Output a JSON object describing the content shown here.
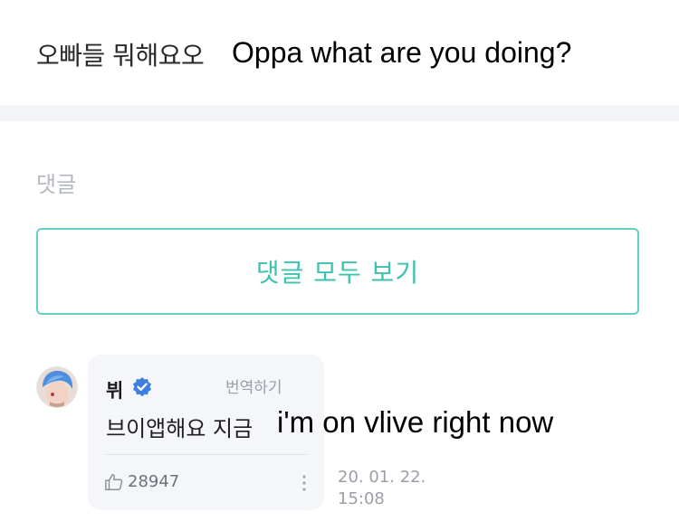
{
  "post": {
    "text": "오빠들 뭐해요오",
    "translation": "Oppa what are you doing?"
  },
  "comments_section": {
    "label": "댓글",
    "view_all_label": "댓글 모두 보기"
  },
  "comment": {
    "author": "뷔",
    "verified": true,
    "translate_label": "번역하기",
    "text": "브이앱해요 지금",
    "translation": "i'm on vlive right now",
    "likes": "28947",
    "timestamp_line1": "20. 01. 22.",
    "timestamp_line2": "15:08"
  },
  "colors": {
    "accent": "#3bc3ad",
    "verified_blue": "#3d7fe0",
    "divider": "#f3f5f9",
    "bubble": "#f4f6f9"
  },
  "icons": [
    "verified-badge-icon",
    "thumbs-up-icon",
    "more-options-icon"
  ]
}
